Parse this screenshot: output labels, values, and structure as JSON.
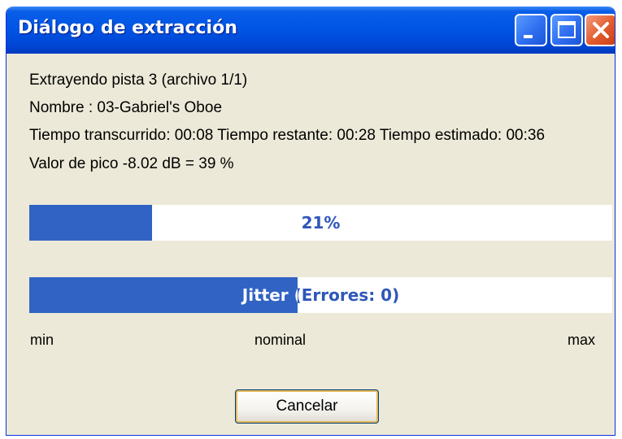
{
  "window": {
    "title": "Diálogo de extracción"
  },
  "info": {
    "track_line": "Extrayendo pista 3 (archivo 1/1)",
    "name_line": "Nombre : 03-Gabriel's Oboe",
    "time_line": "Tiempo transcurrido: 00:08 Tiempo restante: 00:28 Tiempo estimado: 00:36",
    "peak_line": "Valor de pico -8.02 dB =  39 %"
  },
  "progress": {
    "label": "21%",
    "value": 0.21
  },
  "jitter": {
    "label": "Jitter (Errores: 0)",
    "value": 0.46
  },
  "scale": {
    "min": "min",
    "nominal": "nominal",
    "max": "max"
  },
  "buttons": {
    "cancel": "Cancelar"
  },
  "colors": {
    "bar_fill": "#3163c5",
    "bar_text": "#2e57b8",
    "titlebar": "#0055e5",
    "close_button": "#e35a2c"
  },
  "icons": {
    "minimize": "minimize-icon",
    "maximize": "maximize-icon",
    "close": "close-icon"
  }
}
